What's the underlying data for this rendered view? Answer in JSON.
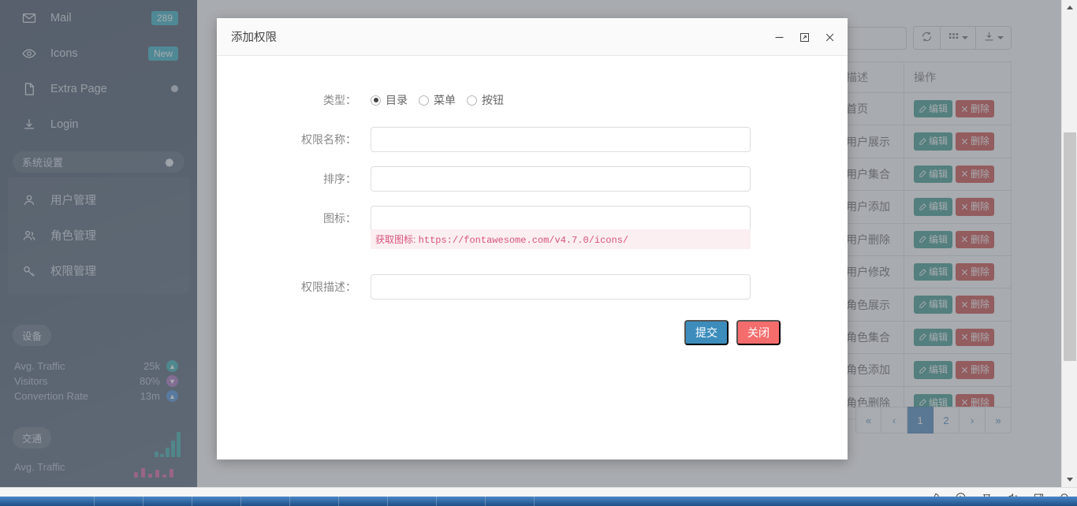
{
  "sidebar": {
    "menu_items": [
      {
        "label": "Mail",
        "icon": "mail-icon",
        "badge": "289",
        "badge_type": "count"
      },
      {
        "label": "Icons",
        "icon": "eye-icon",
        "badge": "New",
        "badge_type": "new"
      },
      {
        "label": "Extra Page",
        "icon": "file-icon",
        "badge": "",
        "badge_type": "dot"
      },
      {
        "label": "Login",
        "icon": "download-icon",
        "badge": "",
        "badge_type": "none"
      }
    ],
    "system_section": {
      "title": "系统设置",
      "gear_icon": "gear-icon",
      "items": [
        {
          "label": "用户管理",
          "icon": "user-icon"
        },
        {
          "label": "角色管理",
          "icon": "users-icon"
        },
        {
          "label": "权限管理",
          "icon": "key-icon"
        }
      ]
    },
    "device_section": {
      "title": "设备",
      "stats": [
        {
          "name": "Avg. Traffic",
          "value": "25k",
          "trend": "up",
          "color": "#17a2a8"
        },
        {
          "name": "Visitors",
          "value": "80%",
          "trend": "down",
          "color": "#9b5cb5"
        },
        {
          "name": "Convertion Rate",
          "value": "13m",
          "trend": "up",
          "color": "#2f7fd1"
        }
      ]
    },
    "traffic_section": {
      "title": "交通",
      "label": "Avg. Traffic"
    }
  },
  "toolbar": {
    "search_placeholder": "",
    "search_value": "",
    "refresh_icon": "refresh-icon",
    "columns_icon": "grid-icon",
    "export_icon": "download-icon"
  },
  "table": {
    "headers": [
      "描述",
      "操作"
    ],
    "rows": [
      {
        "desc": "首页",
        "edit": "编辑",
        "delete": "删除"
      },
      {
        "desc": "用户展示",
        "edit": "编辑",
        "delete": "删除"
      },
      {
        "desc": "用户集合",
        "edit": "编辑",
        "delete": "删除"
      },
      {
        "desc": "用户添加",
        "edit": "编辑",
        "delete": "删除"
      },
      {
        "desc": "用户删除",
        "edit": "编辑",
        "delete": "删除"
      },
      {
        "desc": "用户修改",
        "edit": "编辑",
        "delete": "删除"
      },
      {
        "desc": "角色展示",
        "edit": "编辑",
        "delete": "删除"
      },
      {
        "desc": "角色集合",
        "edit": "编辑",
        "delete": "删除"
      },
      {
        "desc": "角色添加",
        "edit": "编辑",
        "delete": "删除"
      },
      {
        "desc": "角色删除",
        "edit": "编辑",
        "delete": "删除"
      }
    ]
  },
  "pagination": {
    "first": "«",
    "prev": "‹",
    "pages": [
      "1",
      "2"
    ],
    "active_page": "1",
    "next": "›",
    "last": "»"
  },
  "modal": {
    "title": "添加权限",
    "minimize_icon": "minimize-icon",
    "maximize_icon": "maximize-icon",
    "close_icon": "close-icon",
    "fields": {
      "type_label": "类型：",
      "type_options": [
        "目录",
        "菜单",
        "按钮"
      ],
      "type_selected": "目录",
      "name_label": "权限名称：",
      "name_value": "",
      "sort_label": "排序：",
      "sort_value": "",
      "icon_label": "图标：",
      "icon_value": "",
      "icon_hint_prefix": "获取图标: ",
      "icon_hint_url": "https://fontawesome.com/v4.7.0/icons/",
      "desc_label": "权限描述：",
      "desc_value": ""
    },
    "submit_label": "提交",
    "close_label": "关闭"
  },
  "bottom_bar": {
    "icons": [
      "rocket-icon",
      "shield-icon",
      "trash-icon",
      "speaker-icon",
      "window-icon",
      "search-icon"
    ]
  },
  "colors": {
    "accent_blue": "#3c8dbc",
    "danger_red": "#f56c6c",
    "edit_teal": "#218c7e",
    "delete_red": "#c9302c",
    "badge_teal": "#19a5bd",
    "pager_active": "#337ab7"
  }
}
